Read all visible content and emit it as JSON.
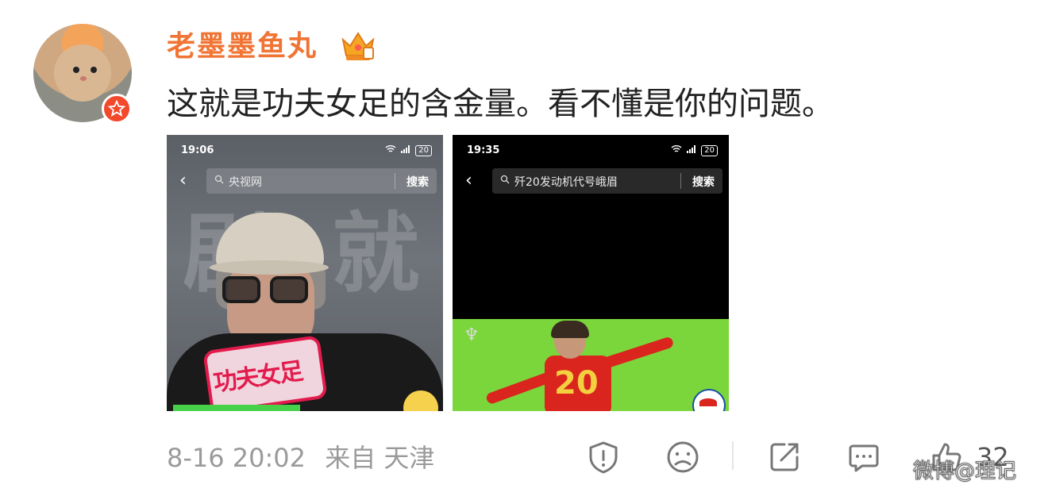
{
  "post": {
    "username": "老墨墨鱼丸",
    "content": "这就是功夫女足的含金量。看不懂是你的问题。",
    "timestamp": "8-16 20:02",
    "source": "来自 天津",
    "like_count": "32",
    "watermark": "微博@理记"
  },
  "images": [
    {
      "status_time": "19:06",
      "battery": "20",
      "search_query": "央视网",
      "search_button": "搜索",
      "poster_text": "功夫女足"
    },
    {
      "status_time": "19:35",
      "battery": "20",
      "search_query": "歼20发动机代号峨眉",
      "search_button": "搜索",
      "jersey_number": "20"
    }
  ],
  "icons": {
    "report": "shield-alert-icon",
    "mood": "sad-face-icon",
    "share": "share-icon",
    "comment": "comment-icon",
    "like": "thumbs-up-icon"
  },
  "colors": {
    "username": "#f07434",
    "badge": "#f2482b",
    "meta": "#9a9a9a"
  }
}
